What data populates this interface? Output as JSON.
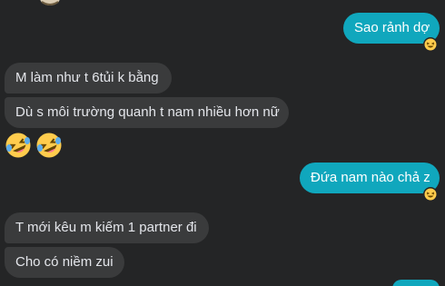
{
  "conversation": {
    "messages": [
      {
        "direction": "outgoing",
        "text": "Sao rảnh dợ",
        "reaction": "laughing-emoji"
      },
      {
        "direction": "incoming",
        "text": "M làm như t 6tủi k bằng"
      },
      {
        "direction": "incoming",
        "text": "Dù s môi trường quanh t nam nhiều hơn nữ"
      },
      {
        "direction": "incoming",
        "emoji": [
          "rolling-on-floor-laughing-emoji",
          "rolling-on-floor-laughing-emoji"
        ]
      },
      {
        "direction": "outgoing",
        "text": "Đứa nam nào chả z",
        "reaction": "laughing-emoji"
      },
      {
        "direction": "incoming",
        "text": "T mới kêu m kiếm 1 partner đi"
      },
      {
        "direction": "incoming",
        "text": "Cho có niềm zui"
      }
    ]
  },
  "colors": {
    "background": "#242526",
    "incoming_bubble": "#3a3b3c",
    "outgoing_bubble": "#10a7bd",
    "text_light": "#e4e6eb",
    "text_white": "#ffffff",
    "emoji_yellow": "#ffcc4d"
  }
}
